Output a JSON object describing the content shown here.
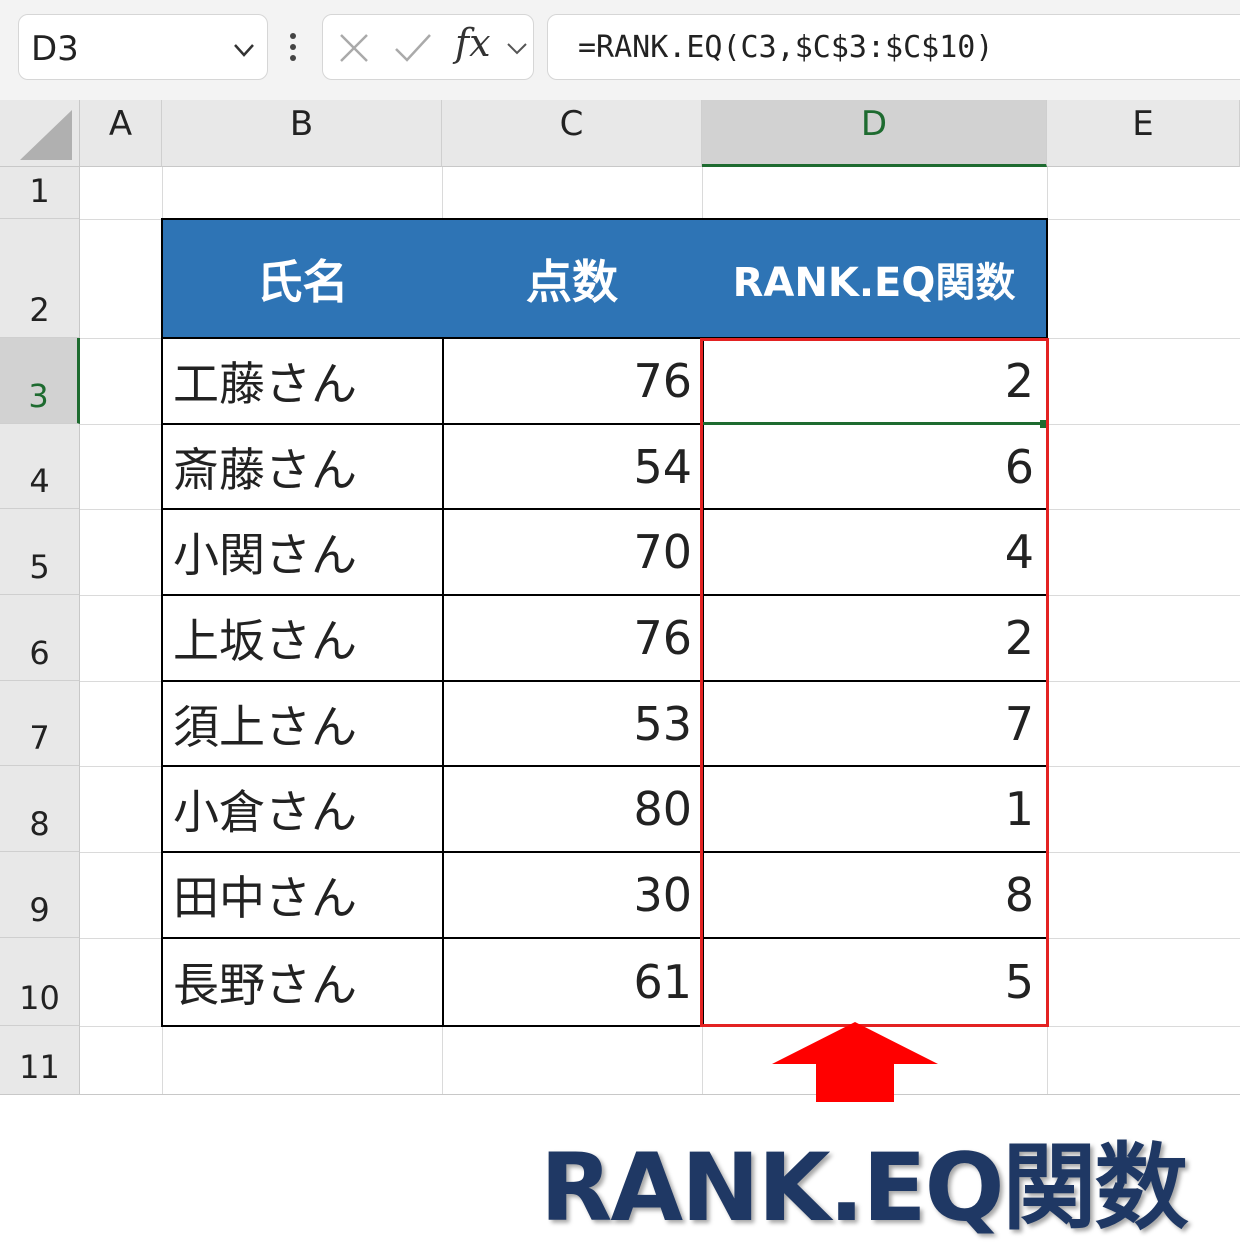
{
  "formula_bar": {
    "name_box": "D3",
    "fx_label": "fx",
    "formula": "=RANK.EQ(C3,$C$3:$C$10)"
  },
  "columns": [
    "A",
    "B",
    "C",
    "D",
    "E"
  ],
  "rows": [
    "1",
    "2",
    "3",
    "4",
    "5",
    "6",
    "7",
    "8",
    "9",
    "10",
    "11"
  ],
  "table": {
    "headers": [
      "氏名",
      "点数",
      "RANK.EQ関数"
    ],
    "data": [
      {
        "name": "工藤さん",
        "score": "76",
        "rank": "2"
      },
      {
        "name": "斎藤さん",
        "score": "54",
        "rank": "6"
      },
      {
        "name": "小関さん",
        "score": "70",
        "rank": "4"
      },
      {
        "name": "上坂さん",
        "score": "76",
        "rank": "2"
      },
      {
        "name": "須上さん",
        "score": "53",
        "rank": "7"
      },
      {
        "name": "小倉さん",
        "score": "80",
        "rank": "1"
      },
      {
        "name": "田中さん",
        "score": "30",
        "rank": "8"
      },
      {
        "name": "長野さん",
        "score": "61",
        "rank": "5"
      }
    ]
  },
  "caption": "RANK.EQ関数",
  "colors": {
    "header_fill": "#2e74b5",
    "highlight_box": "#e32222",
    "arrow": "#ff0000",
    "caption": "#1f3864",
    "selection": "#1e6b30"
  }
}
